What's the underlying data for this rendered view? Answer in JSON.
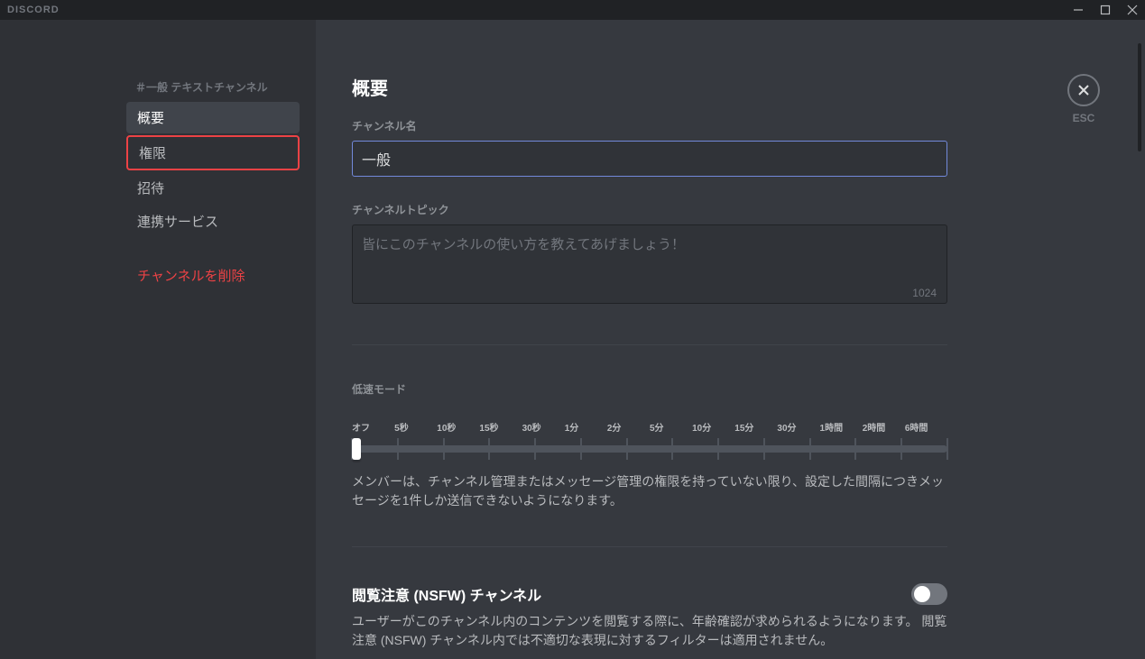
{
  "titlebar": {
    "brand": "DISCORD"
  },
  "sidebar": {
    "header_prefix": "＃一般",
    "header_suffix": " テキストチャンネル",
    "items": [
      {
        "label": "概要",
        "active": true
      },
      {
        "label": "権限",
        "active": false,
        "highlighted": true
      },
      {
        "label": "招待",
        "active": false
      },
      {
        "label": "連携サービス",
        "active": false
      }
    ],
    "delete_label": "チャンネルを削除"
  },
  "main": {
    "page_title": "概要",
    "channel_name_label": "チャンネル名",
    "channel_name_value": "一般",
    "topic_label": "チャンネルトピック",
    "topic_placeholder": "皆にこのチャンネルの使い方を教えてあげましょう！",
    "topic_char_count": "1024",
    "slowmode": {
      "label": "低速モード",
      "ticks": [
        "オフ",
        "5秒",
        "10秒",
        "15秒",
        "30秒",
        "1分",
        "2分",
        "5分",
        "10分",
        "15分",
        "30分",
        "1時間",
        "2時間",
        "6時間"
      ],
      "help": "メンバーは、チャンネル管理またはメッセージ管理の権限を持っていない限り、設定した間隔につきメッセージを1件しか送信できないようになります。"
    },
    "nsfw": {
      "title": "閲覧注意 (NSFW) チャンネル",
      "help": "ユーザーがこのチャンネル内のコンテンツを閲覧する際に、年齢確認が求められるようになります。 閲覧注意 (NSFW) チャンネル内では不適切な表現に対するフィルターは適用されません。"
    }
  },
  "esc_label": "ESC"
}
